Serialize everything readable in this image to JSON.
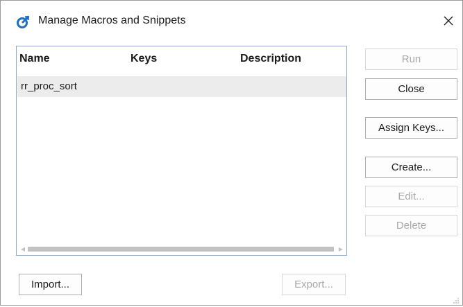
{
  "window": {
    "title": "Manage Macros and Snippets",
    "icon": "macro-app-icon",
    "close_icon": "close-icon"
  },
  "list": {
    "columns": [
      "Name",
      "Keys",
      "Description"
    ],
    "rows": [
      {
        "name": "rr_proc_sort",
        "keys": "",
        "description": ""
      }
    ],
    "selected_row_color": "#ececec",
    "border_color": "#8fa9c8"
  },
  "buttons": {
    "run": {
      "label": "Run",
      "enabled": false
    },
    "close": {
      "label": "Close",
      "enabled": true
    },
    "assign_keys": {
      "label": "Assign Keys...",
      "enabled": true
    },
    "create": {
      "label": "Create...",
      "enabled": true
    },
    "edit": {
      "label": "Edit...",
      "enabled": false
    },
    "delete": {
      "label": "Delete",
      "enabled": false
    },
    "import": {
      "label": "Import...",
      "enabled": true
    },
    "export": {
      "label": "Export...",
      "enabled": false
    }
  },
  "colors": {
    "accent_icon": "#1f6fc5",
    "disabled_text": "#a8a8a8"
  }
}
